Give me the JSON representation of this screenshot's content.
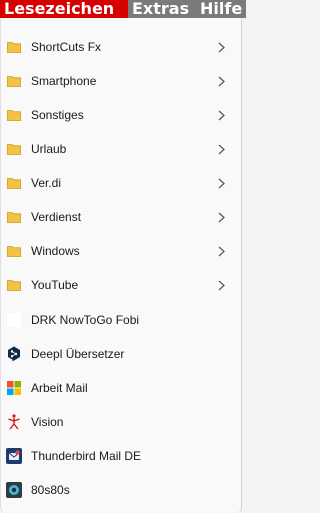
{
  "menubar": {
    "items": [
      {
        "label": "Lesezeichen"
      },
      {
        "label": "Extras"
      },
      {
        "label": "Hilfe"
      }
    ]
  },
  "bookmarks": {
    "folders": [
      {
        "label": "ShortCuts Fx"
      },
      {
        "label": "Smartphone"
      },
      {
        "label": "Sonstiges"
      },
      {
        "label": "Urlaub"
      },
      {
        "label": "Ver.di"
      },
      {
        "label": "Verdienst"
      },
      {
        "label": "Windows"
      },
      {
        "label": "YouTube"
      }
    ],
    "links": [
      {
        "label": "DRK NowToGo Fobi",
        "icon": "blank-page-icon"
      },
      {
        "label": "Deepl Übersetzer",
        "icon": "deepl-icon"
      },
      {
        "label": "Arbeit Mail",
        "icon": "microsoft-icon"
      },
      {
        "label": "Vision",
        "icon": "vision-icon"
      },
      {
        "label": "Thunderbird Mail DE",
        "icon": "thunderbird-icon"
      },
      {
        "label": "80s80s",
        "icon": "radio-icon"
      }
    ]
  },
  "colors": {
    "active_menu": "#d60000",
    "folder": "#f5c342",
    "chevron": "#555555"
  }
}
